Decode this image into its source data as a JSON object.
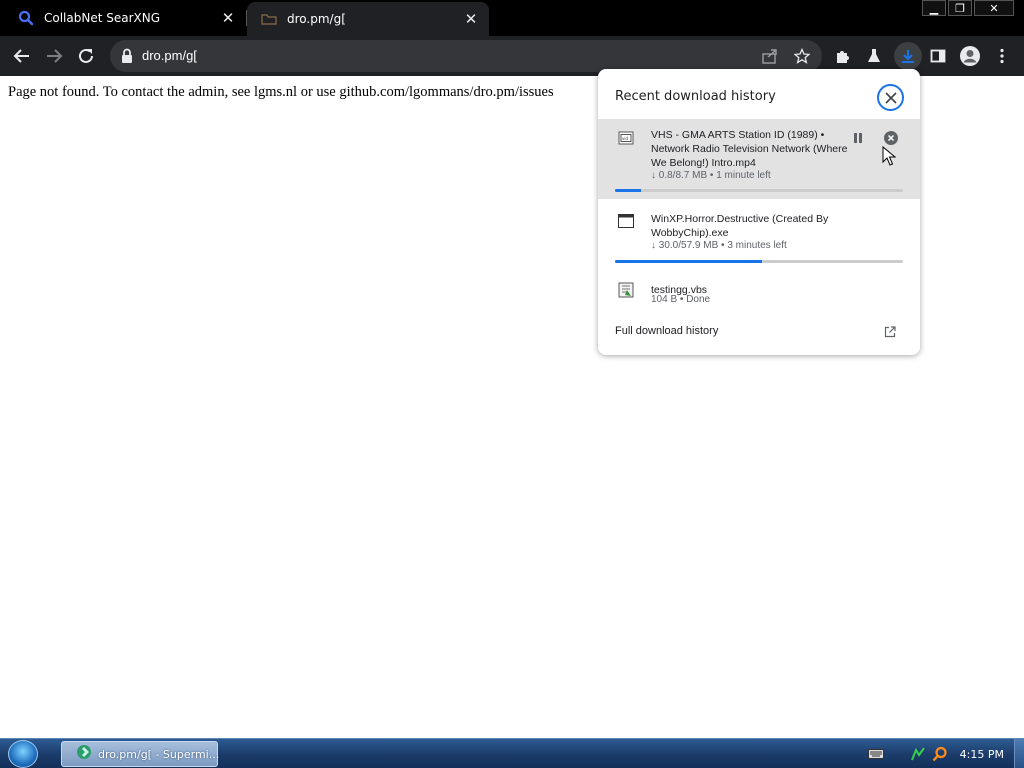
{
  "tabs": [
    {
      "title": "CollabNet SearXNG",
      "icon": "search-icon"
    },
    {
      "title": "dro.pm/g[",
      "icon": "folder-favicon-icon"
    }
  ],
  "toolbar": {
    "url": "dro.pm/g["
  },
  "page": {
    "message": "Page not found. To contact the admin, see lgms.nl or use github.com/lgommans/dro.pm/issues"
  },
  "downloads": {
    "title": "Recent download history",
    "items": [
      {
        "name": "VHS - GMA ARTS Station ID (1989) • Network Radio Television Network (Where We Belong!) Intro.mp4",
        "name_visible": "VHS - GMA ARTS Station ID (1989) • Network Radio Television Network (Where We Belong!) Intro.mp4",
        "status": "↓ 0.8/8.7 MB • 1 minute left",
        "progress": 0.09
      },
      {
        "name": "WinXP.Horror.Destructive  (Created By WobbyChip).exe",
        "status": "↓ 30.0/57.9 MB • 3 minutes left",
        "progress": 0.51
      },
      {
        "name": "testingg.vbs",
        "status": "104 B • Done"
      }
    ],
    "full_history": "Full download history"
  },
  "taskbar": {
    "task_label": "dro.pm/g[ - Supermi...",
    "clock": "4:15 PM"
  },
  "colors": {
    "accent": "#1a73e8",
    "toolbar_bg": "#202124",
    "tab_active_bg": "#202124",
    "omnibox_bg": "#35363a"
  }
}
